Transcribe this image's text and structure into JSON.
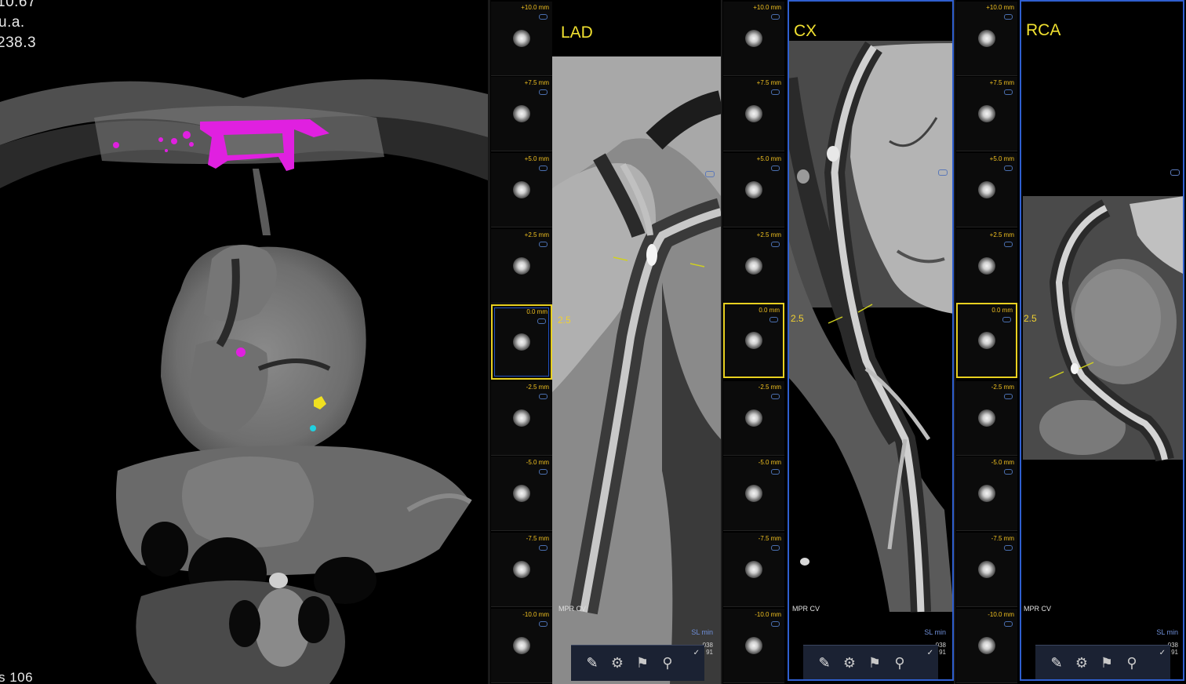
{
  "axial": {
    "info_line1": "10.67",
    "info_line2": "u.a.",
    "info_line3": "238.3",
    "bottom_text": "s 106"
  },
  "offsets": [
    "+10.0 mm",
    "+7.5 mm",
    "+5.0 mm",
    "+2.5 mm",
    "0.0 mm",
    "-2.5 mm",
    "-5.0 mm",
    "-7.5 mm",
    "-10.0 mm"
  ],
  "views": [
    {
      "title": "LAD",
      "scale": "2.5",
      "mode": "MPR CV",
      "sl": "SL min",
      "num1": "038",
      "num2": "91"
    },
    {
      "title": "CX",
      "scale": "2.5",
      "mode": "MPR CV",
      "sl": "SL min",
      "num1": "038",
      "num2": "91"
    },
    {
      "title": "RCA",
      "scale": "2.5",
      "mode": "MPR CV",
      "sl": "SL min",
      "num1": "038",
      "num2": "91"
    }
  ],
  "toolbar_icons": [
    "measure-tool-icon",
    "gear-icon",
    "flag-icon",
    "vessel-tool-icon"
  ],
  "colors": {
    "calcium_lm": "#e020e0",
    "calcium_lad": "#f0e020",
    "calcium_cx": "#20d0e0",
    "label_yellow": "#f0e030",
    "frame_blue": "#2f5fd0"
  }
}
